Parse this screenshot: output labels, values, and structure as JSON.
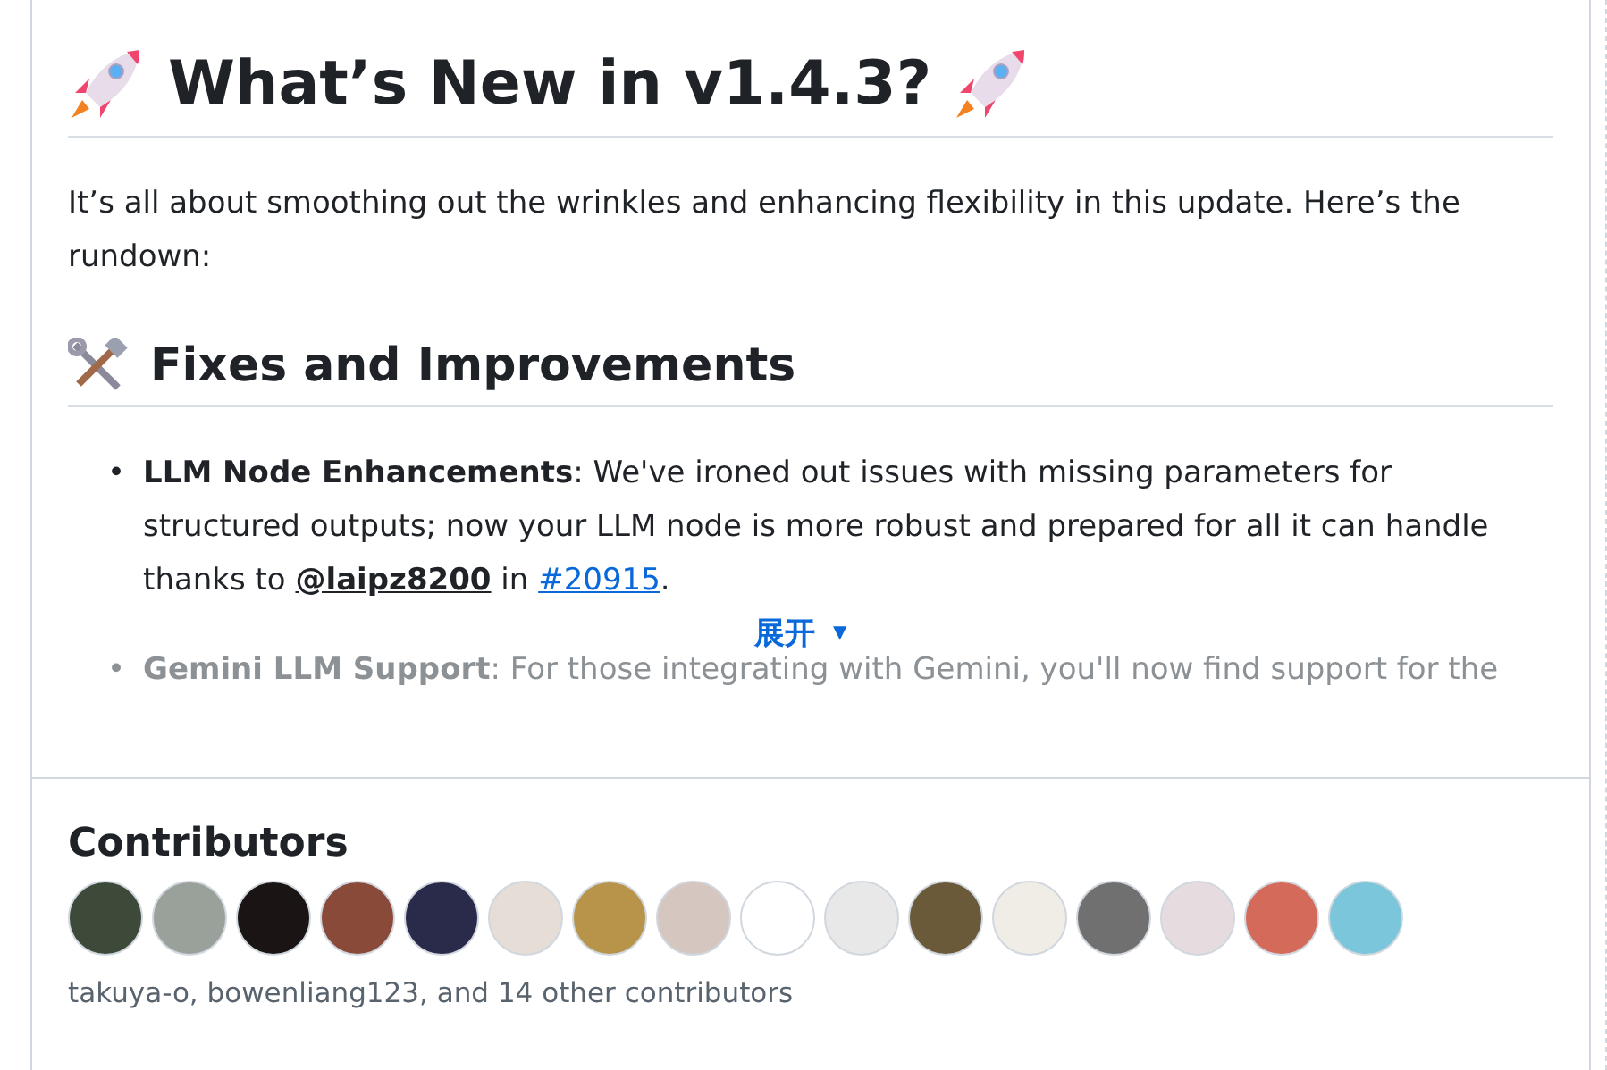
{
  "release": {
    "title": "What’s New in v1.4.3?",
    "intro": "It’s all about smoothing out the wrinkles and enhancing flexibility in this update. Here’s the rundown:",
    "section_title": "Fixes and Improvements",
    "items": [
      {
        "bullet": "•",
        "text": "**LLM Node Enhancements**: We've ironed out issues with missing parameters for structured outputs; now your LLM node is more robust and prepared for all it can handle thanks to ",
        "mention": "@laipz8200",
        "joiner": " in ",
        "link": "#20915",
        "end": ".",
        "faded": false
      },
      {
        "bullet": "•",
        "text": "**Gemini LLM Support**: For those integrating with Gemini, you'll now find support for the",
        "faded": true
      }
    ],
    "expand": {
      "label": "展开",
      "caret": "▼"
    }
  },
  "contributors": {
    "title": "Contributors",
    "avatars": [
      {
        "color": "#3d4a3a"
      },
      {
        "color": "#9aa09a"
      },
      {
        "color": "#1a1414"
      },
      {
        "color": "#8a4a3a"
      },
      {
        "color": "#2a2a4a"
      },
      {
        "color": "#e6ded6"
      },
      {
        "color": "#b8944a"
      },
      {
        "color": "#d6c6c0"
      },
      {
        "color": "#ffffff"
      },
      {
        "color": "#e8e8e8"
      },
      {
        "color": "#6a5a3a"
      },
      {
        "color": "#f0ece6"
      },
      {
        "color": "#707070"
      },
      {
        "color": "#e6dce0"
      },
      {
        "color": "#d46a5a"
      },
      {
        "color": "#7cc6dc"
      }
    ],
    "summary": "takuya-o, bowenliang123, and 14 other contributors"
  }
}
